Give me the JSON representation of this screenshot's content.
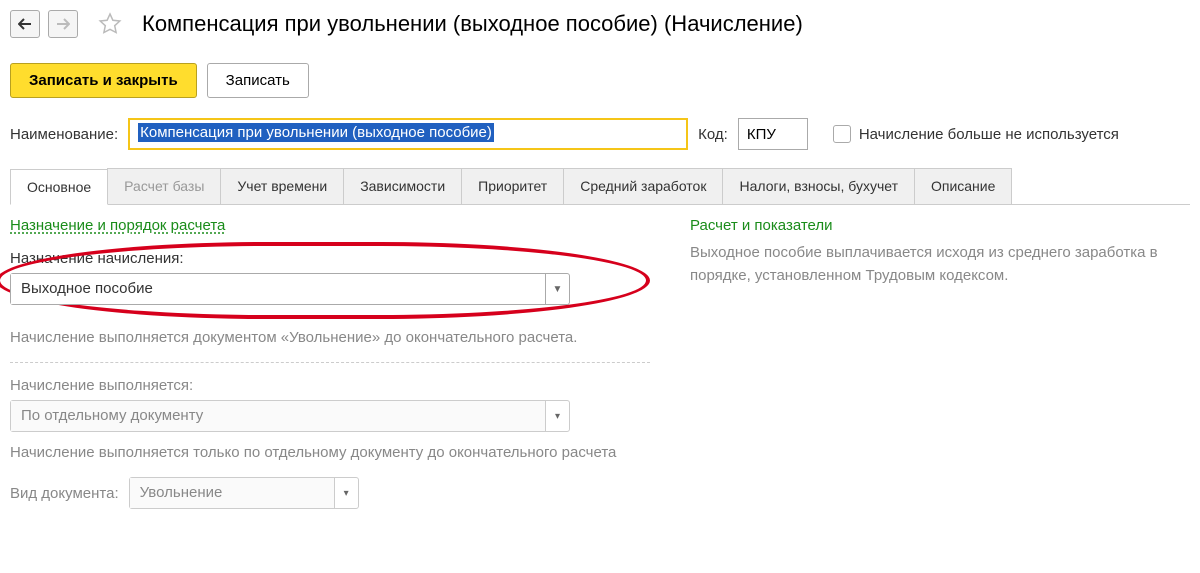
{
  "header": {
    "title": "Компенсация при увольнении (выходное пособие) (Начисление)"
  },
  "toolbar": {
    "save_close": "Записать и закрыть",
    "save": "Записать"
  },
  "form": {
    "name_label": "Наименование:",
    "name_value": "Компенсация при увольнении (выходное пособие)",
    "code_label": "Код:",
    "code_value": "КПУ",
    "unused_label": "Начисление больше не используется"
  },
  "tabs": {
    "t0": "Основное",
    "t1": "Расчет базы",
    "t2": "Учет времени",
    "t3": "Зависимости",
    "t4": "Приоритет",
    "t5": "Средний заработок",
    "t6": "Налоги, взносы, бухучет",
    "t7": "Описание"
  },
  "main": {
    "section1_title": "Назначение и порядок расчета",
    "purpose_label": "Назначение начисления:",
    "purpose_value": "Выходное пособие",
    "info1": "Начисление выполняется документом «Увольнение» до окончательного расчета.",
    "exec_label": "Начисление выполняется:",
    "exec_value": "По отдельному документу",
    "info2": "Начисление выполняется только по отдельному документу до окончательного расчета",
    "doc_label": "Вид документа:",
    "doc_value": "Увольнение"
  },
  "right": {
    "section_title": "Расчет и показатели",
    "text": "Выходное пособие выплачивается исходя из среднего заработка в порядке, установленном Трудовым кодексом."
  }
}
